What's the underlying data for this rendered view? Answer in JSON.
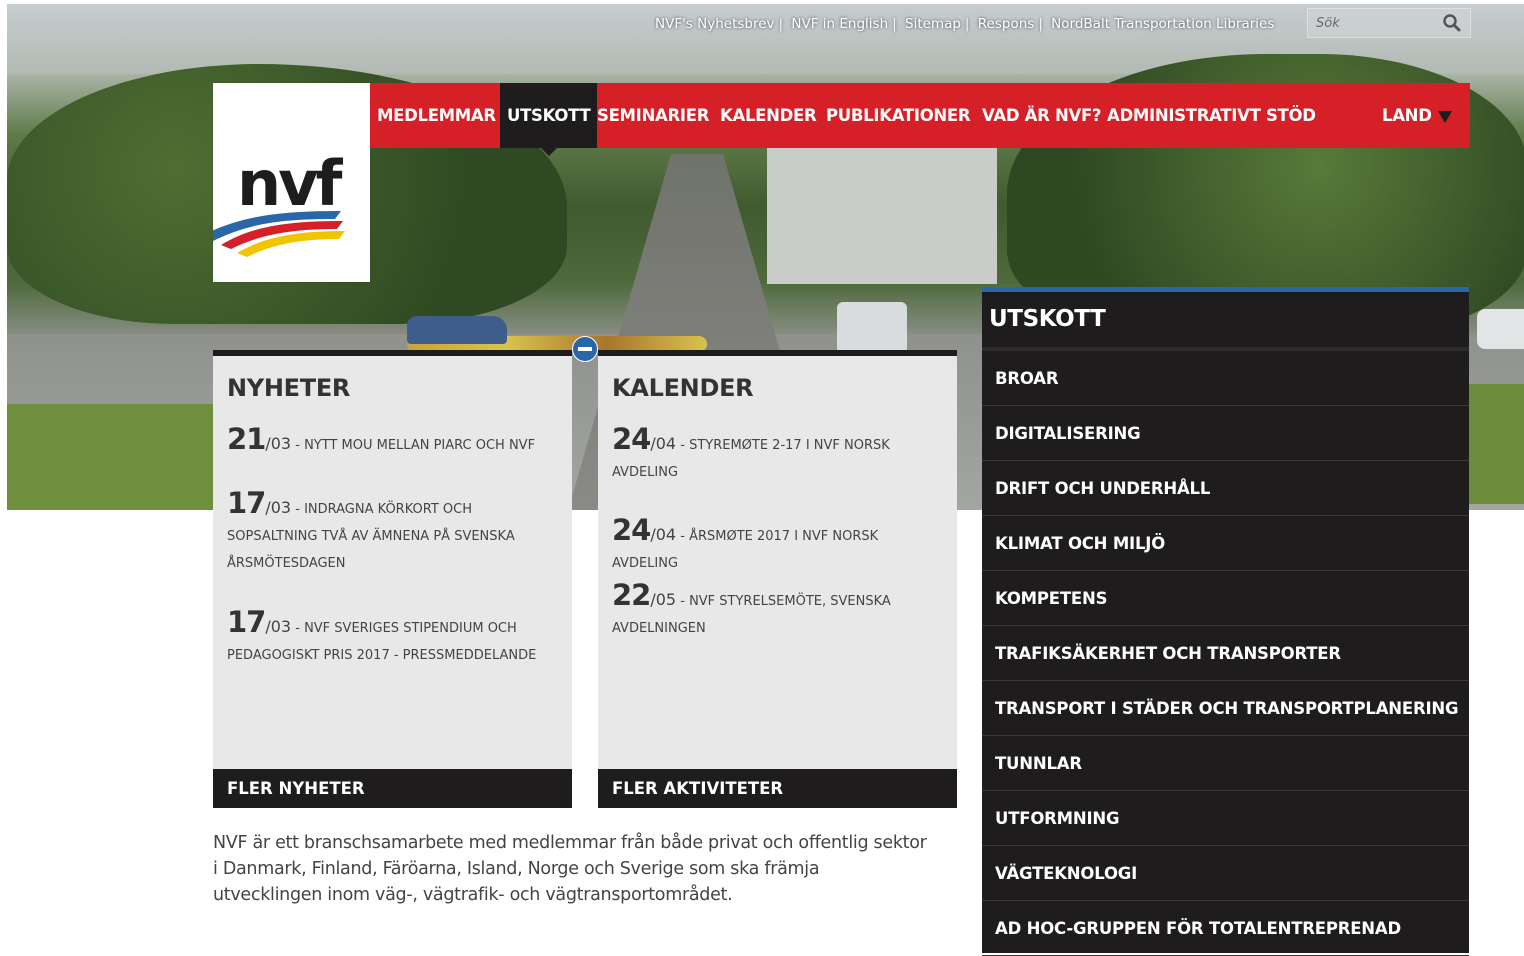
{
  "top_links": [
    "NVF's Nyhetsbrev",
    "NVF in English",
    "Sitemap",
    "Respons",
    "NordBalt Transportation Libraries"
  ],
  "search": {
    "placeholder": "Sök"
  },
  "nav": {
    "items": [
      "MEDLEMMAR",
      "UTSKOTT",
      "SEMINARIER",
      "KALENDER",
      "PUBLIKATIONER",
      "VAD ÄR NVF?",
      "ADMINISTRATIVT STÖD"
    ],
    "active": "UTSKOTT",
    "land": "LAND"
  },
  "logo": {
    "text": "nvf"
  },
  "news": {
    "title": "NYHETER",
    "items": [
      {
        "day": "21",
        "month": "/03",
        "text": " - NYTT MOU MELLAN PIARC OCH NVF"
      },
      {
        "day": "17",
        "month": "/03",
        "text": " - INDRAGNA KÖRKORT OCH SOPSALTNING TVÅ AV ÄMNENA PÅ SVENSKA ÅRSMÖTESDAGEN"
      },
      {
        "day": "17",
        "month": "/03",
        "text": " - NVF SVERIGES STIPENDIUM OCH PEDAGOGISKT PRIS 2017 - PRESSMEDDELANDE"
      }
    ],
    "more": "FLER NYHETER"
  },
  "calendar": {
    "title": "KALENDER",
    "items": [
      {
        "day": "24",
        "month": "/04",
        "text": " - STYREMØTE 2-17 I NVF NORSK AVDELING"
      },
      {
        "day": "24",
        "month": "/04",
        "text": " - ÅRSMØTE 2017 I NVF NORSK AVDELING"
      },
      {
        "day": "22",
        "month": "/05",
        "text": " - NVF STYRELSEMÖTE, SVENSKA AVDELNINGEN"
      }
    ],
    "more": "FLER AKTIVITETER"
  },
  "about": "NVF är ett branschsamarbete med medlemmar från både privat och offentlig sektor i Danmark, Finland, Färöarna, Island, Norge och Sverige som ska främja utvecklingen inom väg-, vägtrafik- och vägtransportområdet.",
  "sidebar": {
    "title": "UTSKOTT",
    "items": [
      "BROAR",
      "DIGITALISERING",
      "DRIFT OCH UNDERHÅLL",
      "KLIMAT OCH MILJÖ",
      "KOMPETENS",
      "TRAFIKSÄKERHET OCH TRANSPORTER",
      "TRANSPORT I STÄDER OCH TRANSPORTPLANERING",
      "TUNNLAR",
      "UTFORMNING",
      "VÄGTEKNOLOGI",
      "AD HOC-GRUPPEN FÖR TOTALENTREPRENAD"
    ]
  },
  "colors": {
    "brand_red": "#d62027",
    "dark": "#1f1c1d",
    "accent_blue": "#2a67a8",
    "panel_bg": "#e8e8e8"
  }
}
